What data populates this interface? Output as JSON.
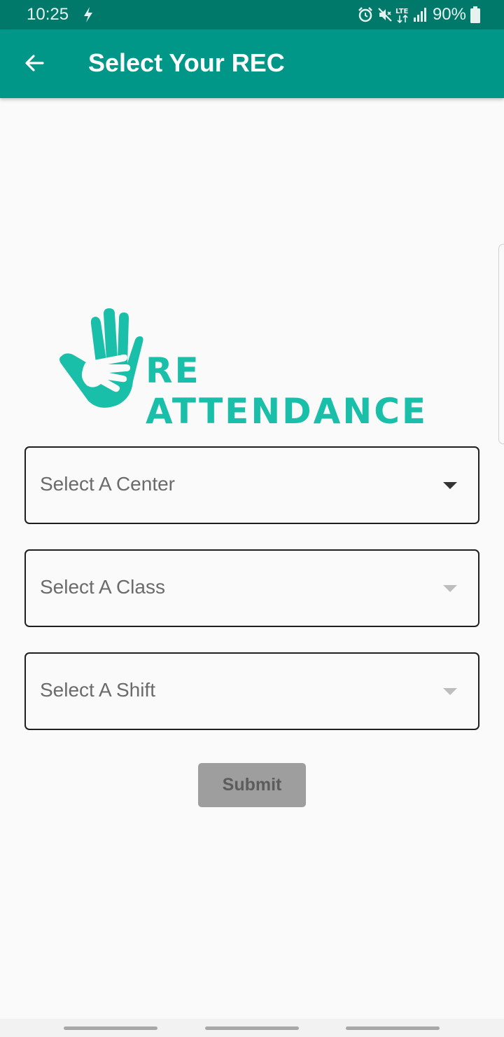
{
  "status_bar": {
    "time": "10:25",
    "battery": "90%",
    "network": "LTE",
    "icons": [
      "bolt-icon",
      "alarm-icon",
      "mute-icon",
      "lte-icon",
      "signal-icon",
      "battery-icon"
    ]
  },
  "app_bar": {
    "title": "Select Your REC",
    "back_icon": "arrow-left-icon",
    "background": "#009688"
  },
  "logo": {
    "text": "RE ATTENDANCE",
    "color": "#19bfa8"
  },
  "form": {
    "center": {
      "placeholder": "Select A Center",
      "enabled": true
    },
    "class": {
      "placeholder": "Select A Class",
      "enabled": false
    },
    "shift": {
      "placeholder": "Select A Shift",
      "enabled": false
    },
    "submit_label": "Submit"
  },
  "colors": {
    "status_bar": "#00796b",
    "accent": "#009688",
    "disabled_button": "#9e9e9e"
  }
}
